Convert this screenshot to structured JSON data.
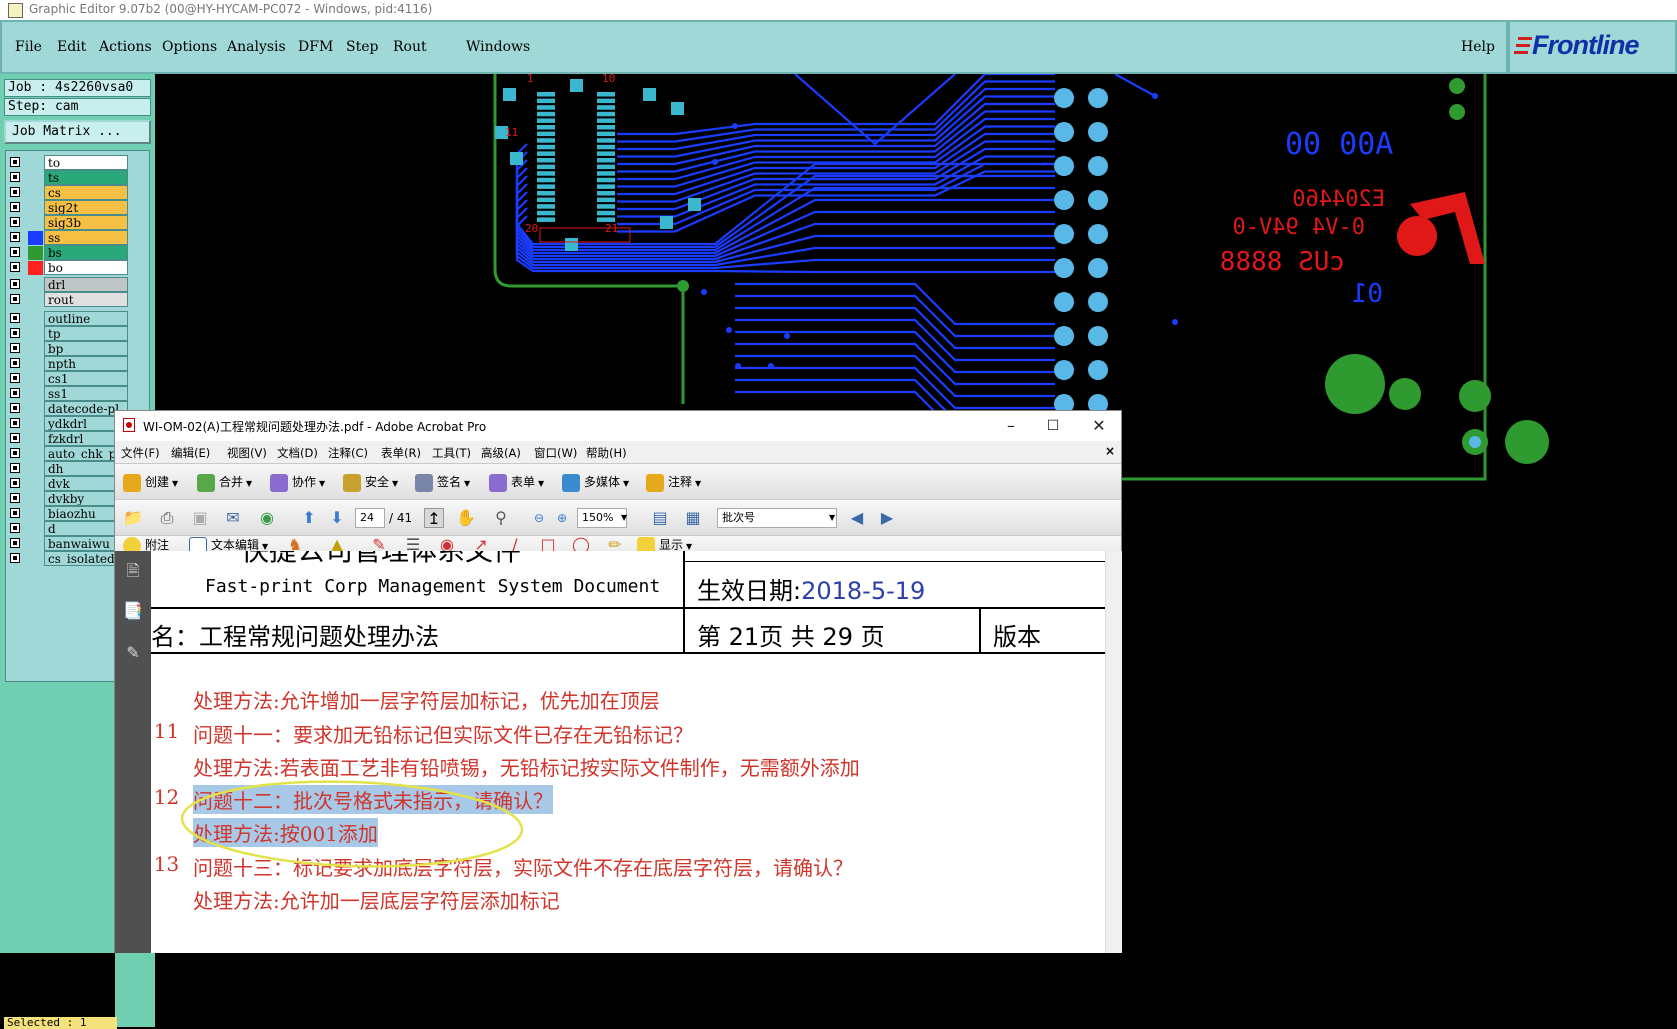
{
  "app": {
    "title": "Graphic Editor 9.07b2 (00@HY-HYCAM-PC072 - Windows, pid:4116)",
    "menu": [
      "File",
      "Edit",
      "Actions",
      "Options",
      "Analysis",
      "DFM",
      "Step",
      "Rout",
      "Windows"
    ],
    "help": "Help",
    "logo_text": "Frontline"
  },
  "left_panel": {
    "job": "Job : 4s2260vsa0",
    "step": "Step: cam",
    "job_matrix_button": "Job Matrix ...",
    "selected": "Selected : 1",
    "layers": [
      {
        "name": "to",
        "color": "#ffffff",
        "swatch": "#9fd8d6"
      },
      {
        "name": "ts",
        "color": "#2aa87a",
        "swatch": "#9fd8d6"
      },
      {
        "name": "cs",
        "color": "#f5c043",
        "swatch": "#9fd8d6"
      },
      {
        "name": "sig2t",
        "color": "#f5c043",
        "swatch": "#9fd8d6"
      },
      {
        "name": "sig3b",
        "color": "#f5c043",
        "swatch": "#9fd8d6"
      },
      {
        "name": "ss",
        "color": "#f5c043",
        "swatch": "#1a3cff"
      },
      {
        "name": "bs",
        "color": "#2aa87a",
        "swatch": "#2f9a2f"
      },
      {
        "name": "bo",
        "color": "#ffffff",
        "swatch": "#ff2020"
      },
      {
        "name": "drl",
        "color": "#bfc5c5",
        "swatch": "#9fd8d6"
      },
      {
        "name": "rout",
        "color": "#e0e0e0",
        "swatch": "#9fd8d6"
      },
      {
        "name": "outline",
        "color": "#9fd8d6",
        "swatch": "#9fd8d6"
      },
      {
        "name": "tp",
        "color": "#9fd8d6",
        "swatch": "#9fd8d6"
      },
      {
        "name": "bp",
        "color": "#9fd8d6",
        "swatch": "#9fd8d6"
      },
      {
        "name": "npth",
        "color": "#9fd8d6",
        "swatch": "#9fd8d6"
      },
      {
        "name": "cs1",
        "color": "#9fd8d6",
        "swatch": "#9fd8d6"
      },
      {
        "name": "ss1",
        "color": "#9fd8d6",
        "swatch": "#9fd8d6"
      },
      {
        "name": "datecode-pl",
        "color": "#9fd8d6",
        "swatch": "#9fd8d6"
      },
      {
        "name": "ydkdrl",
        "color": "#9fd8d6",
        "swatch": "#9fd8d6"
      },
      {
        "name": "fzkdrl",
        "color": "#9fd8d6",
        "swatch": "#9fd8d6"
      },
      {
        "name": "auto_chk_pi",
        "color": "#9fd8d6",
        "swatch": "#9fd8d6"
      },
      {
        "name": "dh",
        "color": "#9fd8d6",
        "swatch": "#9fd8d6"
      },
      {
        "name": "dvk",
        "color": "#9fd8d6",
        "swatch": "#9fd8d6"
      },
      {
        "name": "dvkby",
        "color": "#9fd8d6",
        "swatch": "#9fd8d6"
      },
      {
        "name": "biaozhu",
        "color": "#9fd8d6",
        "swatch": "#9fd8d6"
      },
      {
        "name": "d",
        "color": "#9fd8d6",
        "swatch": "#9fd8d6"
      },
      {
        "name": "banwaiwu",
        "color": "#9fd8d6",
        "swatch": "#9fd8d6"
      },
      {
        "name": "cs_isolated",
        "color": "#9fd8d6",
        "swatch": "#9fd8d6"
      }
    ]
  },
  "pcb": {
    "silk_text_1": "00  00A",
    "silk_text_2": "E204460",
    "silk_text_3": "0-V4 94V-0",
    "silk_text_4": "cUS 8888",
    "silk_text_5": "01",
    "pin_label_1": "1",
    "pin_label_2": "10",
    "pin_label_3": "11",
    "pin_label_4": "20",
    "pin_label_5": "21"
  },
  "acrobat": {
    "title": "WI-OM-02(A)工程常规问题处理办法.pdf - Adobe Acrobat Pro",
    "menu": [
      "文件(F)",
      "编辑(E)",
      "视图(V)",
      "文档(D)",
      "注释(C)",
      "表单(R)",
      "工具(T)",
      "高级(A)",
      "窗口(W)",
      "帮助(H)"
    ],
    "close_doc": "×",
    "toolbar1": [
      "创建",
      "合并",
      "协作",
      "安全",
      "签名",
      "表单",
      "多媒体",
      "注释"
    ],
    "page_current": "24",
    "page_total": "/ 41",
    "zoom": "150%",
    "search_value": "批次号",
    "toolbar3": {
      "note": "附注",
      "text_edit": "文本编辑",
      "show": "显示"
    }
  },
  "document": {
    "header_cn_partial": "快捷公司管理体系文件",
    "header_en": "Fast-print Corp Management System Document",
    "effective_label": "生效日期:",
    "effective_date": "2018-5-19",
    "doc_name": "名：工程常规问题处理办法",
    "page_info": "第 21页 共 29 页",
    "version": "版本",
    "lines": [
      {
        "num": "",
        "text": "处理方法:允许增加一层字符层加标记，优先加在顶层"
      },
      {
        "num": ". 11",
        "text": "问题十一：要求加无铅标记但实际文件已存在无铅标记？"
      },
      {
        "num": "",
        "text": "处理方法:若表面工艺非有铅喷锡，无铅标记按实际文件制作，无需额外添加"
      },
      {
        "num": ". 12",
        "text": "问题十二：批次号格式未指示，请确认？"
      },
      {
        "num": "",
        "text": "处理方法:按001添加"
      },
      {
        "num": ". 13",
        "text": "问题十三：标记要求加底层字符层，实际文件不存在底层字符层，请确认？"
      },
      {
        "num": "",
        "text": "处理方法:允许加一层底层字符层添加标记"
      }
    ]
  }
}
